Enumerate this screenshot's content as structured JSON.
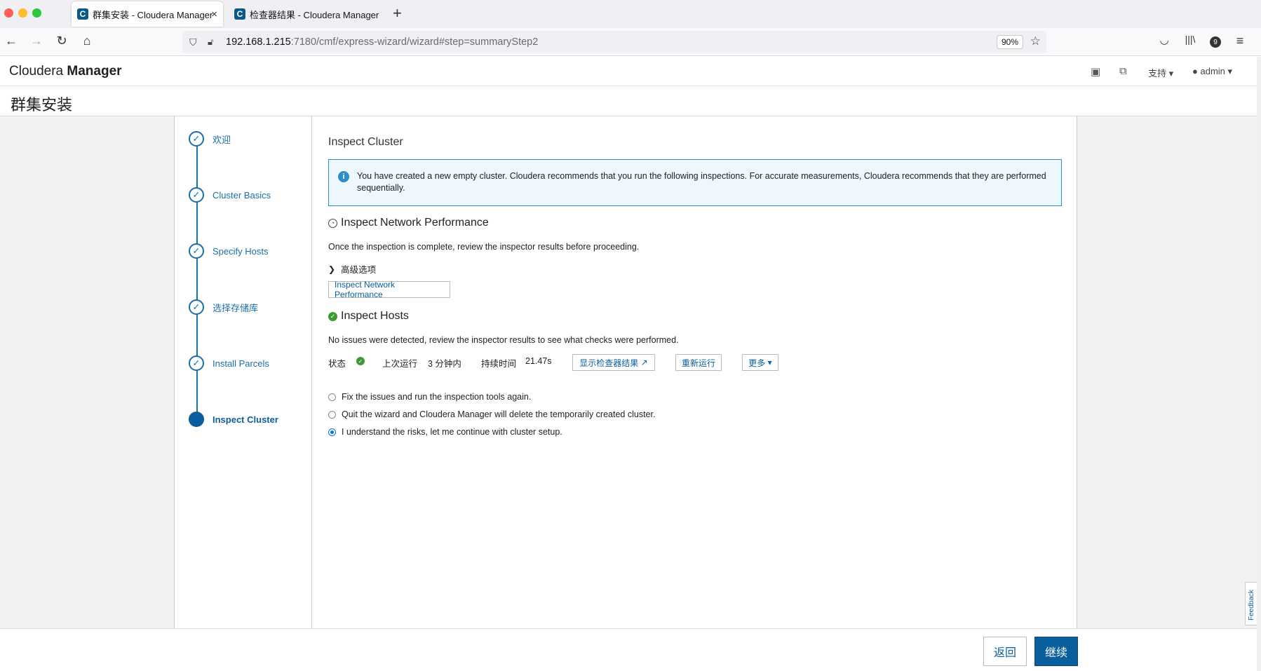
{
  "browser": {
    "tabs": [
      {
        "title": "群集安装 - Cloudera Manager",
        "favicon": "C",
        "active": true
      },
      {
        "title": "检查器结果 - Cloudera Manager",
        "favicon": "C",
        "active": false
      }
    ],
    "new_tab_icon": "+",
    "close_icon": "×",
    "url_host": "192.168.1.215",
    "url_rest": ":7180/cmf/express-wizard/wizard#step=summaryStep2",
    "zoom": "90%",
    "notification_count": "9"
  },
  "header": {
    "brand_light": "Cloudera",
    "brand_bold": "Manager",
    "support_label": "支持",
    "user_label": "admin"
  },
  "page": {
    "title": "群集安装"
  },
  "steps": [
    {
      "label": "欢迎",
      "state": "done"
    },
    {
      "label": "Cluster Basics",
      "state": "done"
    },
    {
      "label": "Specify Hosts",
      "state": "done"
    },
    {
      "label": "选择存储库",
      "state": "done"
    },
    {
      "label": "Install Parcels",
      "state": "done"
    },
    {
      "label": "Inspect Cluster",
      "state": "current"
    }
  ],
  "main": {
    "section_title": "Inspect Cluster",
    "info_text": "You have created a new empty cluster. Cloudera recommends that you run the following inspections. For accurate measurements, Cloudera recommends that they are performed sequentially.",
    "network": {
      "title": "Inspect Network Performance",
      "description": "Once the inspection is complete, review the inspector results before proceeding.",
      "advanced_label": "高级选项",
      "button_label": "Inspect Network Performance"
    },
    "hosts": {
      "title": "Inspect Hosts",
      "description": "No issues were detected, review the inspector results to see what checks were performed.",
      "status_label": "状态",
      "last_run_label": "上次运行",
      "last_run_value": "3 分钟内",
      "duration_label": "持续时间",
      "duration_value": "21.47s",
      "show_results_label": "显示检查器结果",
      "rerun_label": "重新运行",
      "more_label": "更多"
    },
    "options": [
      {
        "label": "Fix the issues and run the inspection tools again.",
        "checked": false
      },
      {
        "label": "Quit the wizard and Cloudera Manager will delete the temporarily created cluster.",
        "checked": false
      },
      {
        "label": "I understand the risks, let me continue with cluster setup.",
        "checked": true
      }
    ]
  },
  "footer": {
    "back_label": "返回",
    "next_label": "继续"
  },
  "feedback_label": "Feedback",
  "colors": {
    "accent": "#0b5e9c",
    "link": "#1a6fa8",
    "success": "#3c9a32",
    "info_border": "#2d8fc7"
  }
}
